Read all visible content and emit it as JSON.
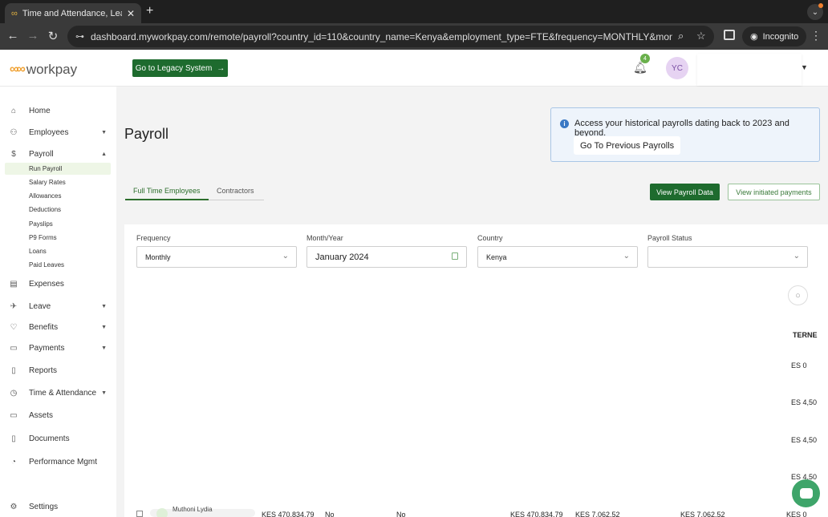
{
  "browser": {
    "tab_title": "Time and Attendance, Leave,",
    "new_tab": "+",
    "url": "dashboard.myworkpay.com/remote/payroll?country_id=110&country_name=Kenya&employment_type=FTE&frequency=MONTHLY&month=JANUARY&...",
    "incognito_label": "Incognito"
  },
  "header": {
    "logo_text": "workpay",
    "legacy_button": "Go to Legacy System",
    "notification_count": "4",
    "avatar_initials": "YC"
  },
  "sidebar": {
    "items": [
      {
        "label": "Home",
        "icon": "home-icon"
      },
      {
        "label": "Employees",
        "icon": "users-icon"
      },
      {
        "label": "Payroll",
        "icon": "dollar-icon"
      },
      {
        "label": "Expenses",
        "icon": "receipt-icon"
      },
      {
        "label": "Leave",
        "icon": "plane-icon"
      },
      {
        "label": "Benefits",
        "icon": "heart-icon"
      },
      {
        "label": "Payments",
        "icon": "payment-icon"
      },
      {
        "label": "Reports",
        "icon": "report-icon"
      },
      {
        "label": "Time & Attendance",
        "icon": "clock-icon"
      },
      {
        "label": "Assets",
        "icon": "laptop-icon"
      },
      {
        "label": "Documents",
        "icon": "document-icon"
      },
      {
        "label": "Performance Mgmt",
        "icon": "chart-icon"
      },
      {
        "label": "Settings",
        "icon": "gear-icon"
      }
    ],
    "payroll_sub": [
      "Run Payroll",
      "Salary Rates",
      "Allowances",
      "Deductions",
      "Payslips",
      "P9 Forms",
      "Loans",
      "Paid Leaves"
    ]
  },
  "main": {
    "title": "Payroll",
    "info_message": "Access your historical payrolls dating back to 2023 and beyond.",
    "previous_payrolls_button": "Go To Previous Payrolls",
    "tabs": [
      "Full Time Employees",
      "Contractors"
    ],
    "view_payroll_data": "View Payroll Data",
    "view_initiated_payments": "View initiated payments",
    "filters": {
      "frequency_label": "Frequency",
      "frequency_value": "Monthly",
      "month_label": "Month/Year",
      "month_value": "January 2024",
      "country_label": "Country",
      "country_value": "Kenya",
      "status_label": "Payroll Status",
      "status_value": ""
    },
    "table": {
      "partial_header": "TERNE",
      "partial_values": [
        "ES 0",
        "ES 4,50",
        "ES 4,50",
        "ES 4,50"
      ],
      "bottom_row": {
        "name": "Muthoni Lydia",
        "gross": "KES 470,834.79",
        "col2": "No",
        "col3": "No",
        "col4": "KES 470,834.79",
        "col5": "KES 7,062.52",
        "col6": "KES 7,062.52",
        "col7": "KES 0"
      }
    }
  }
}
